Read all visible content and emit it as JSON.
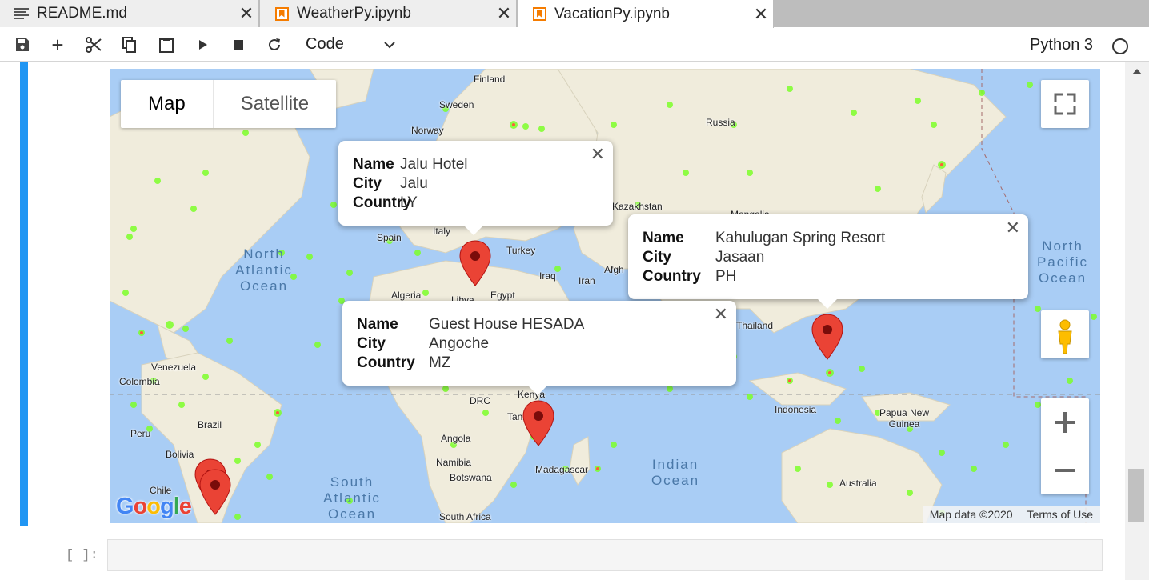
{
  "tabs": [
    {
      "label": "README.md",
      "icon": "text-file-icon",
      "active": false
    },
    {
      "label": "WeatherPy.ipynb",
      "icon": "notebook-icon",
      "active": false
    },
    {
      "label": "VacationPy.ipynb",
      "icon": "notebook-icon",
      "active": true
    }
  ],
  "toolbar": {
    "cell_type": "Code",
    "kernel": "Python 3"
  },
  "map": {
    "type_buttons": {
      "map": "Map",
      "satellite": "Satellite"
    },
    "country_labels": [
      "Finland",
      "Sweden",
      "Norway",
      "Russia",
      "Kazakhstan",
      "Mongolia",
      "Spain",
      "Italy",
      "Turkey",
      "Iraq",
      "Iran",
      "Afgh",
      "Algeria",
      "Libya",
      "Egypt",
      "Thailand",
      "Venezuela",
      "Colombia",
      "Brazil",
      "Peru",
      "Bolivia",
      "Chile",
      "DRC",
      "Kenya",
      "Tanzania",
      "Angola",
      "Namibia",
      "Botswana",
      "Madagascar",
      "Indonesia",
      "Papua New Guinea",
      "Australia",
      "South Africa"
    ],
    "ocean_labels": [
      "North Atlantic Ocean",
      "North Pacific Ocean",
      "South Atlantic Ocean",
      "Indian Ocean"
    ],
    "info_windows": [
      {
        "name_label": "Name",
        "city_label": "City",
        "country_label": "Country",
        "name": "Jalu Hotel",
        "city": "Jalu",
        "country": "LY"
      },
      {
        "name_label": "Name",
        "city_label": "City",
        "country_label": "Country",
        "name": "Kahulugan Spring Resort",
        "city": "Jasaan",
        "country": "PH"
      },
      {
        "name_label": "Name",
        "city_label": "City",
        "country_label": "Country",
        "name": "Guest House HESADA",
        "city": "Angoche",
        "country": "MZ"
      }
    ],
    "attribution": {
      "data": "Map data ©2020",
      "terms": "Terms of Use"
    },
    "logo": "Google"
  },
  "cell": {
    "prompt": "[ ]:"
  }
}
